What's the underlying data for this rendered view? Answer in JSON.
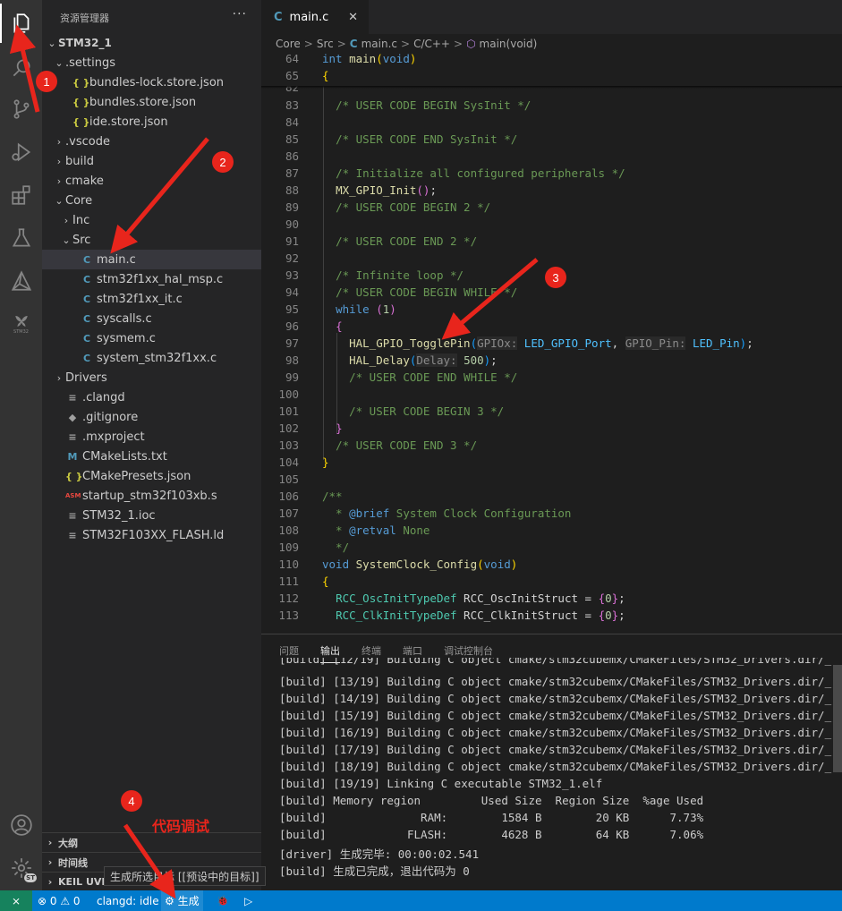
{
  "activity_bar": {
    "icons": [
      "explorer-icon",
      "search-icon",
      "source-control-icon",
      "run-debug-icon",
      "extensions-icon",
      "testing-icon",
      "cmake-icon",
      "stm32-icon",
      "account-icon",
      "settings-gear-icon"
    ],
    "stm32_label": "STM32",
    "settings_badge": "ST"
  },
  "sidebar": {
    "title": "资源管理器",
    "more": "···",
    "root": "STM32_1",
    "tree": [
      {
        "label": ".settings",
        "type": "folder-open",
        "depth": 1
      },
      {
        "label": "bundles-lock.store.json",
        "type": "json",
        "depth": 2
      },
      {
        "label": "bundles.store.json",
        "type": "json",
        "depth": 2
      },
      {
        "label": "ide.store.json",
        "type": "json",
        "depth": 2
      },
      {
        "label": ".vscode",
        "type": "folder",
        "depth": 1
      },
      {
        "label": "build",
        "type": "folder",
        "depth": 1
      },
      {
        "label": "cmake",
        "type": "folder",
        "depth": 1
      },
      {
        "label": "Core",
        "type": "folder-open",
        "depth": 1
      },
      {
        "label": "Inc",
        "type": "folder",
        "depth": 2
      },
      {
        "label": "Src",
        "type": "folder-open",
        "depth": 2
      },
      {
        "label": "main.c",
        "type": "c",
        "depth": 3,
        "selected": true
      },
      {
        "label": "stm32f1xx_hal_msp.c",
        "type": "c",
        "depth": 3
      },
      {
        "label": "stm32f1xx_it.c",
        "type": "c",
        "depth": 3
      },
      {
        "label": "syscalls.c",
        "type": "c",
        "depth": 3
      },
      {
        "label": "sysmem.c",
        "type": "c",
        "depth": 3
      },
      {
        "label": "system_stm32f1xx.c",
        "type": "c",
        "depth": 3
      },
      {
        "label": "Drivers",
        "type": "folder",
        "depth": 1
      },
      {
        "label": ".clangd",
        "type": "txt",
        "depth": 1
      },
      {
        "label": ".gitignore",
        "type": "git",
        "depth": 1
      },
      {
        "label": ".mxproject",
        "type": "txt",
        "depth": 1
      },
      {
        "label": "CMakeLists.txt",
        "type": "m",
        "depth": 1
      },
      {
        "label": "CMakePresets.json",
        "type": "json",
        "depth": 1
      },
      {
        "label": "startup_stm32f103xb.s",
        "type": "asm",
        "depth": 1
      },
      {
        "label": "STM32_1.ioc",
        "type": "txt",
        "depth": 1
      },
      {
        "label": "STM32F103XX_FLASH.ld",
        "type": "txt",
        "depth": 1
      }
    ],
    "sections": [
      "大纲",
      "时间线",
      "KEIL UVIS"
    ]
  },
  "editor": {
    "tab": {
      "icon": "C",
      "label": "main.c",
      "close": "✕"
    },
    "breadcrumb": [
      "Core",
      ">",
      "Src",
      ">",
      "C",
      "main.c",
      ">",
      "C/C++",
      ">",
      "main(void)"
    ]
  },
  "panel": {
    "tabs": [
      "问题",
      "输出",
      "终端",
      "端口",
      "调试控制台"
    ],
    "active_tab": "输出",
    "lines": [
      "[build] [12/19] Building C object cmake/stm32cubemx/CMakeFiles/STM32_Drivers.dir/_",
      "[build] [13/19] Building C object cmake/stm32cubemx/CMakeFiles/STM32_Drivers.dir/_",
      "[build] [14/19] Building C object cmake/stm32cubemx/CMakeFiles/STM32_Drivers.dir/_",
      "[build] [15/19] Building C object cmake/stm32cubemx/CMakeFiles/STM32_Drivers.dir/_",
      "[build] [16/19] Building C object cmake/stm32cubemx/CMakeFiles/STM32_Drivers.dir/_",
      "[build] [17/19] Building C object cmake/stm32cubemx/CMakeFiles/STM32_Drivers.dir/_",
      "[build] [18/19] Building C object cmake/stm32cubemx/CMakeFiles/STM32_Drivers.dir/_",
      "[build] [19/19] Linking C executable STM32_1.elf",
      "[build] Memory region         Used Size  Region Size  %age Used",
      "[build]              RAM:        1584 B        20 KB      7.73%",
      "[build]            FLASH:        4628 B        64 KB      7.06%",
      "[driver] 生成完毕: 00:00:02.541",
      "[build] 生成已完成，退出代码为 0"
    ]
  },
  "status_bar": {
    "remote": "⨯",
    "problems": "⊗ 0 ⚠ 0",
    "clangd": "clangd: idle",
    "build": "⚙ 生成",
    "debug": "🐞",
    "run": "▷"
  },
  "tooltip": "生成所选目标 [[预设中的目标]]",
  "annotations": {
    "badges": [
      "1",
      "2",
      "3",
      "4"
    ],
    "note": "代码调试"
  },
  "colors": {
    "statusbar": "#007acc",
    "annotation": "#e8251c"
  }
}
